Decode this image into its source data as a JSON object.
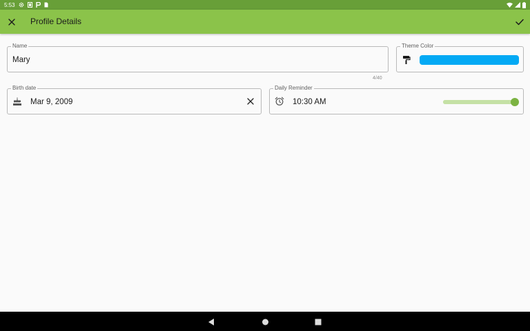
{
  "status_bar": {
    "time": "5:53",
    "left_icons": [
      "gear-icon",
      "square-notification-icon",
      "p-notification-icon",
      "sim-card-icon"
    ],
    "right_icons": [
      "wifi-icon",
      "signal-icon",
      "battery-icon"
    ]
  },
  "app_bar": {
    "title": "Profile Details",
    "close_icon": "close-icon",
    "confirm_icon": "check-icon",
    "background": "#8bc34a"
  },
  "form": {
    "name": {
      "label": "Name",
      "value": "Mary",
      "counter": "4/40"
    },
    "theme_color": {
      "label": "Theme Color",
      "icon": "paint-roller-icon",
      "value": "#03a9f4"
    },
    "birth_date": {
      "label": "Birth date",
      "icon": "cake-icon",
      "value": "Mar 9, 2009",
      "clear_icon": "clear-icon"
    },
    "daily_reminder": {
      "label": "Daily Reminder",
      "icon": "alarm-icon",
      "value": "10:30 AM",
      "toggle_level": 1.0,
      "toggle_color": "#7cb342"
    }
  },
  "nav_bar": {
    "buttons": [
      "back-triangle-icon",
      "home-circle-icon",
      "recents-square-icon"
    ]
  }
}
